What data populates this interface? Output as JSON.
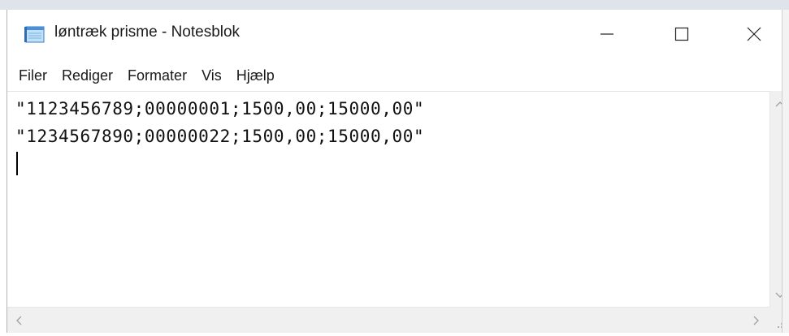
{
  "window": {
    "title": "løntræk prisme - Notesblok"
  },
  "menu": {
    "items": [
      "Filer",
      "Rediger",
      "Formater",
      "Vis",
      "Hjælp"
    ]
  },
  "editor": {
    "lines": [
      "\"1123456789;00000001;1500,00;15000,00\"",
      "\"1234567890;00000022;1500,00;15000,00\""
    ]
  },
  "icons": {
    "app": "notepad-icon",
    "minimize": "minimize-icon",
    "maximize": "maximize-icon",
    "close": "close-icon",
    "scroll_up": "chevron-up-icon",
    "scroll_down": "chevron-down-icon",
    "scroll_left": "chevron-left-icon",
    "scroll_right": "chevron-right-icon",
    "resize": "resize-grip-icon"
  },
  "colors": {
    "window_bg": "#ffffff",
    "scrollbar_bg": "#f0f0f0",
    "text": "#111111",
    "icon_blue": "#4a90d9"
  }
}
